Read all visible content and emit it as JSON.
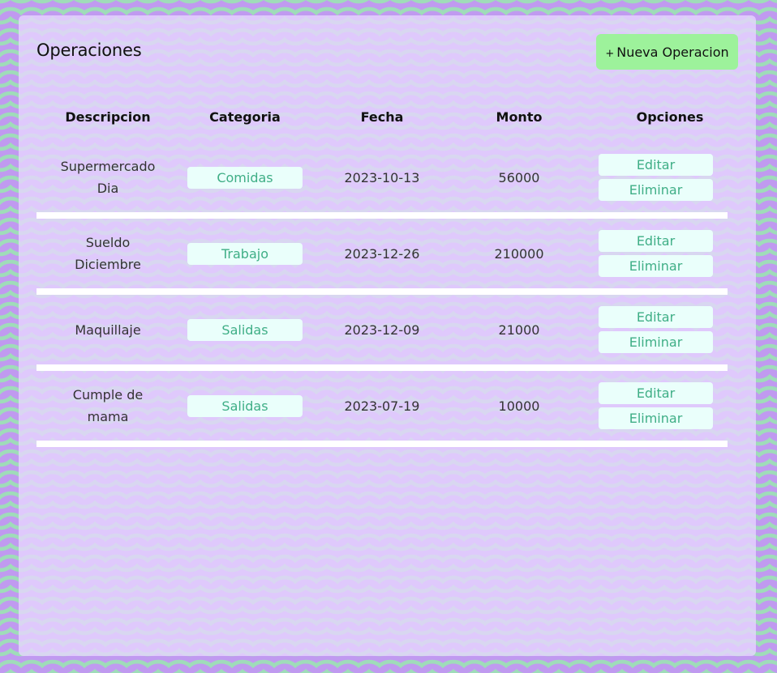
{
  "page": {
    "title": "Operaciones",
    "new_button": "Nueva Operacion",
    "new_button_icon": "+"
  },
  "table": {
    "headers": [
      "Descripcion",
      "Categoria",
      "Fecha",
      "Monto",
      "Opciones"
    ],
    "rows": [
      {
        "descripcion": "Supermercado Dia",
        "categoria": "Comidas",
        "fecha": "2023-10-13",
        "monto": "56000"
      },
      {
        "descripcion": "Sueldo Diciembre",
        "categoria": "Trabajo",
        "fecha": "2023-12-26",
        "monto": "210000"
      },
      {
        "descripcion": "Maquillaje",
        "categoria": "Salidas",
        "fecha": "2023-12-09",
        "monto": "21000"
      },
      {
        "descripcion": "Cumple de mama",
        "categoria": "Salidas",
        "fecha": "2023-07-19",
        "monto": "10000"
      }
    ],
    "edit_label": "Editar",
    "delete_label": "Eliminar"
  },
  "colors": {
    "background": "#c09af0",
    "wave": "#9fdcb9",
    "new_button": "#9df29b",
    "tag_text": "#3fae86",
    "tag_bg": "#eafffb"
  }
}
